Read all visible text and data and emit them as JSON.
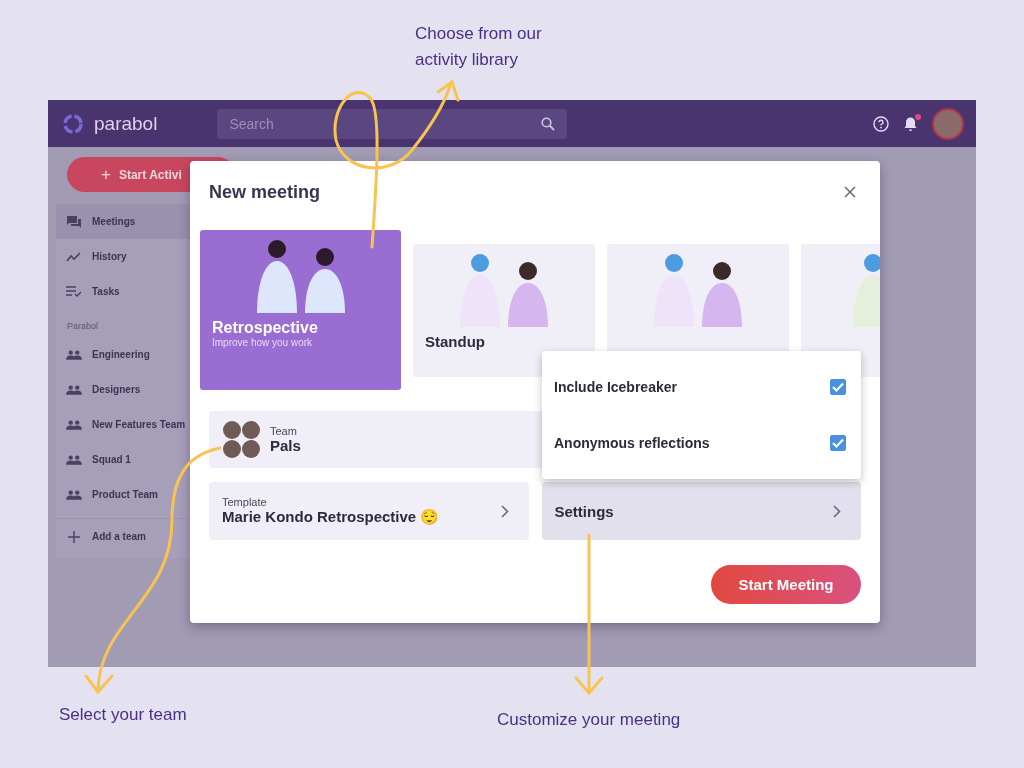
{
  "callouts": {
    "activity": "Choose from our activity library",
    "team": "Select your team",
    "settings": "Customize your meeting"
  },
  "topbar": {
    "brand": "parabol",
    "search": {
      "placeholder": "Search"
    },
    "notification_dot": true
  },
  "sidebar": {
    "start_button": "+",
    "start_label": "Start Activi",
    "items": [
      {
        "label": "Meetings",
        "selected": true
      },
      {
        "label": "History",
        "selected": false
      },
      {
        "label": "Tasks",
        "selected": false
      }
    ],
    "section": "Parabol",
    "teams": [
      {
        "label": "Engineering"
      },
      {
        "label": "Designers"
      },
      {
        "label": "New Features Team"
      },
      {
        "label": "Squad 1"
      },
      {
        "label": "Product Team"
      }
    ],
    "add": "Add a team"
  },
  "modal": {
    "title": "New meeting",
    "activities": [
      {
        "title": "Retrospective",
        "subtitle": "Improve how you work",
        "selected": true
      },
      {
        "title": "Standup",
        "selected": false
      },
      {
        "selected": false
      },
      {
        "selected": false
      }
    ],
    "team": {
      "label": "Team",
      "value": "Pals"
    },
    "template": {
      "label": "Template",
      "value": "Marie Kondo Retrospective 😌"
    },
    "settings": {
      "label": "Settings",
      "options": [
        {
          "label": "Include Icebreaker",
          "checked": true
        },
        {
          "label": "Anonymous reflections",
          "checked": true
        }
      ]
    },
    "start_button": "Start Meeting"
  }
}
